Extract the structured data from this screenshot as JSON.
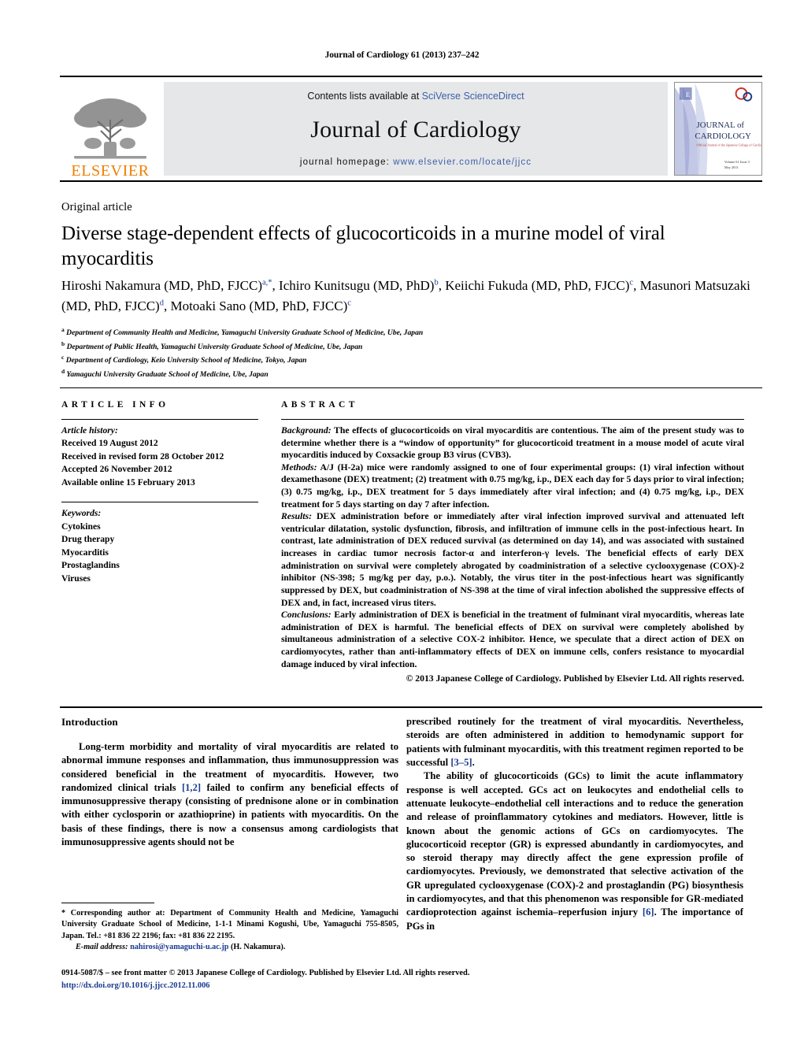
{
  "running_head": "Journal of Cardiology 61 (2013) 237–242",
  "masthead": {
    "contents_prefix": "Contents lists available at ",
    "contents_link": "SciVerse ScienceDirect",
    "journal_name": "Journal of Cardiology",
    "homepage_prefix": "journal homepage: ",
    "homepage_url": "www.elsevier.com/locate/jjcc",
    "publisher_name": "ELSEVIER",
    "cover": {
      "line1": "JOURNAL of",
      "line2": "CARDIOLOGY",
      "subtitle": "Official Journal of the Japanese College of Cardiology",
      "volume_line1": "Volume 61 Issue 3",
      "volume_line2": "May 2013"
    }
  },
  "article_type": "Original article",
  "title": "Diverse stage-dependent effects of glucocorticoids in a murine model of viral myocarditis",
  "authors_html": "Hiroshi Nakamura (MD, PhD, FJCC)<sup>a,<span class=\"star\">*</span></sup>, Ichiro Kunitsugu (MD, PhD)<sup>b</sup>, Keiichi Fukuda (MD, PhD, FJCC)<sup>c</sup>, Masunori Matsuzaki (MD, PhD, FJCC)<sup>d</sup>, Motoaki Sano (MD, PhD, FJCC)<sup>c</sup>",
  "affiliations": [
    {
      "marker": "a",
      "text": "Department of Community Health and Medicine, Yamaguchi University Graduate School of Medicine, Ube, Japan"
    },
    {
      "marker": "b",
      "text": "Department of Public Health, Yamaguchi University Graduate School of Medicine, Ube, Japan"
    },
    {
      "marker": "c",
      "text": "Department of Cardiology, Keio University School of Medicine, Tokyo, Japan"
    },
    {
      "marker": "d",
      "text": "Yamaguchi University Graduate School of Medicine, Ube, Japan"
    }
  ],
  "article_info": {
    "heading": "ARTICLE INFO",
    "history_label": "Article history:",
    "history": [
      "Received 19 August 2012",
      "Received in revised form 28 October 2012",
      "Accepted 26 November 2012",
      "Available online 15 February 2013"
    ],
    "keywords_label": "Keywords:",
    "keywords": [
      "Cytokines",
      "Drug therapy",
      "Myocarditis",
      "Prostaglandins",
      "Viruses"
    ]
  },
  "abstract": {
    "heading": "ABSTRACT",
    "sections": [
      {
        "label": "Background:",
        "text": " The effects of glucocorticoids on viral myocarditis are contentious. The aim of the present study was to determine whether there is a “window of opportunity” for glucocorticoid treatment in a mouse model of acute viral myocarditis induced by Coxsackie group B3 virus (CVB3)."
      },
      {
        "label": "Methods:",
        "text": " A/J (H-2a) mice were randomly assigned to one of four experimental groups: (1) viral infection without dexamethasone (DEX) treatment; (2) treatment with 0.75 mg/kg, i.p., DEX each day for 5 days prior to viral infection; (3) 0.75 mg/kg, i.p., DEX treatment for 5 days immediately after viral infection; and (4) 0.75 mg/kg, i.p., DEX treatment for 5 days starting on day 7 after infection."
      },
      {
        "label": "Results:",
        "text": " DEX administration before or immediately after viral infection improved survival and attenuated left ventricular dilatation, systolic dysfunction, fibrosis, and infiltration of immune cells in the post-infectious heart. In contrast, late administration of DEX reduced survival (as determined on day 14), and was associated with sustained increases in cardiac tumor necrosis factor-α and interferon-γ levels. The beneficial effects of early DEX administration on survival were completely abrogated by coadministration of a selective cyclooxygenase (COX)-2 inhibitor (NS-398; 5 mg/kg per day, p.o.). Notably, the virus titer in the post-infectious heart was significantly suppressed by DEX, but coadministration of NS-398 at the time of viral infection abolished the suppressive effects of DEX and, in fact, increased virus titers."
      },
      {
        "label": "Conclusions:",
        "text": " Early administration of DEX is beneficial in the treatment of fulminant viral myocarditis, whereas late administration of DEX is harmful. The beneficial effects of DEX on survival were completely abolished by simultaneous administration of a selective COX-2 inhibitor. Hence, we speculate that a direct action of DEX on cardiomyocytes, rather than anti-inflammatory effects of DEX on immune cells, confers resistance to myocardial damage induced by viral infection."
      }
    ],
    "copyright": "© 2013 Japanese College of Cardiology. Published by Elsevier Ltd. All rights reserved."
  },
  "body": {
    "intro_heading": "Introduction",
    "left_paragraph_1_html": "Long-term morbidity and mortality of viral myocarditis are related to abnormal immune responses and inflammation, thus immunosuppression was considered beneficial in the treatment of myocarditis. However, two randomized clinical trials <span class=\"ref\">[1,2]</span> failed to confirm any beneficial effects of immunosuppressive therapy (consisting of prednisone alone or in combination with either cyclosporin or azathioprine) in patients with myocarditis. On the basis of these findings, there is now a consensus among cardiologists that immunosuppressive agents should not be",
    "right_paragraph_1_html": "prescribed routinely for the treatment of viral myocarditis. Nevertheless, steroids are often administered in addition to hemodynamic support for patients with fulminant myocarditis, with this treatment regimen reported to be successful <span class=\"ref\">[3–5]</span>.",
    "right_paragraph_2_html": "The ability of glucocorticoids (GCs) to limit the acute inflammatory response is well accepted. GCs act on leukocytes and endothelial cells to attenuate leukocyte–endothelial cell interactions and to reduce the generation and release of proinflammatory cytokines and mediators. However, little is known about the genomic actions of GCs on cardiomyocytes. The glucocorticoid receptor (GR) is expressed abundantly in cardiomyocytes, and so steroid therapy may directly affect the gene expression profile of cardiomyocytes. Previously, we demonstrated that selective activation of the GR upregulated cyclooxygenase (COX)-2 and prostaglandin (PG) biosynthesis in cardiomyocytes, and that this phenomenon was responsible for GR-mediated cardioprotection against ischemia–reperfusion injury <span class=\"ref\">[6]</span>. The importance of PGs in"
  },
  "footnote": {
    "corresponding_html": "* Corresponding author at: Department of Community Health and Medicine, Yamaguchi University Graduate School of Medicine, 1-1-1 Minami Kogushi, Ube, Yamaguchi 755-8505, Japan. Tel.: +81 836 22 2196; fax: +81 836 22 2195.",
    "email_label": "E-mail address:",
    "email": "nahirosi@yamaguchi-u.ac.jp",
    "email_suffix": " (H. Nakamura)."
  },
  "imprint": {
    "line1": "0914-5087/$ – see front matter © 2013 Japanese College of Cardiology. Published by Elsevier Ltd. All rights reserved.",
    "doi": "http://dx.doi.org/10.1016/j.jjcc.2012.11.006"
  }
}
